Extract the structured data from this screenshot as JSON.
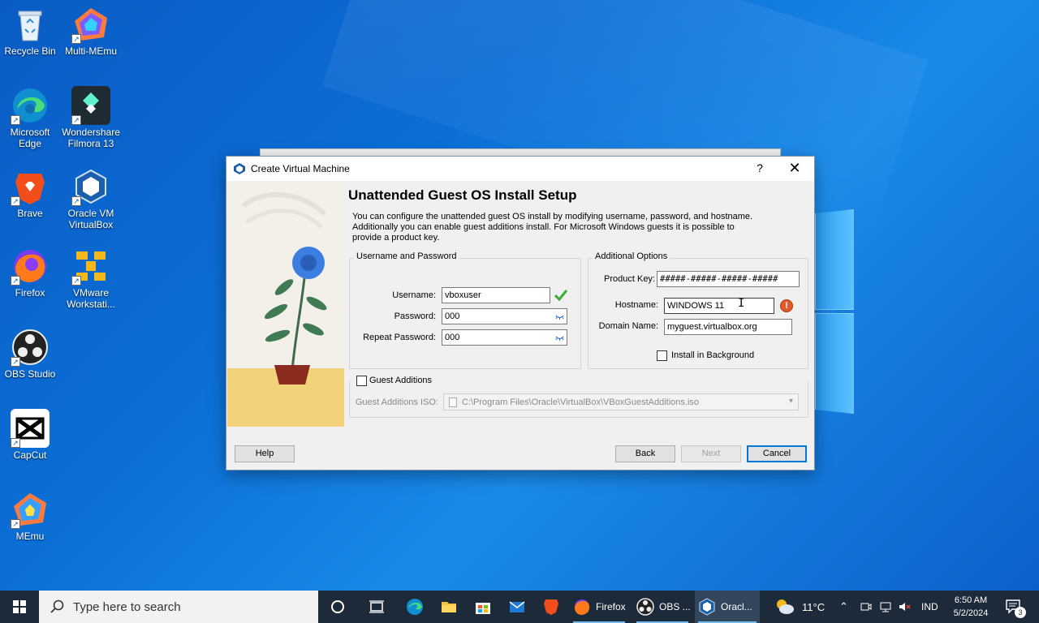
{
  "desktop": {
    "icons": [
      {
        "label": "Recycle Bin",
        "icon": "recycle-bin-icon"
      },
      {
        "label": "Multi-MEmu",
        "icon": "multi-memu-icon"
      },
      {
        "label": "Microsoft Edge",
        "icon": "edge-icon"
      },
      {
        "label": "Wondershare Filmora 13",
        "icon": "filmora-icon"
      },
      {
        "label": "Brave",
        "icon": "brave-icon"
      },
      {
        "label": "Oracle VM VirtualBox",
        "icon": "virtualbox-icon"
      },
      {
        "label": "Firefox",
        "icon": "firefox-icon"
      },
      {
        "label": "VMware Workstati...",
        "icon": "vmware-icon"
      },
      {
        "label": "OBS Studio",
        "icon": "obs-icon"
      },
      {
        "label": "CapCut",
        "icon": "capcut-icon"
      },
      {
        "label": "MEmu",
        "icon": "memu-icon"
      }
    ]
  },
  "dialog": {
    "title": "Create Virtual Machine",
    "help_glyph": "?",
    "close_glyph": "✕",
    "heading": "Unattended Guest OS Install Setup",
    "description": "You can configure the unattended guest OS install by modifying username, password, and hostname. Additionally you can enable guest additions install. For Microsoft Windows guests it is possible to provide a product key.",
    "credentials": {
      "legend": "Username and Password",
      "username_label": "Username:",
      "username_value": "vboxuser",
      "password_label": "Password:",
      "password_value": "000",
      "repeat_label": "Repeat Password:",
      "repeat_value": "000"
    },
    "options": {
      "legend": "Additional Options",
      "product_key_label": "Product Key:",
      "product_key_value": "#####-#####-#####-#####",
      "hostname_label": "Hostname:",
      "hostname_value": "WINDOWS 11",
      "domain_label": "Domain Name:",
      "domain_value": "myguest.virtualbox.org",
      "install_bg_label": "Install in Background",
      "install_bg_checked": false
    },
    "guest_additions": {
      "label": "Guest Additions",
      "checked": false,
      "iso_label": "Guest Additions ISO:",
      "iso_value": "C:\\Program Files\\Oracle\\VirtualBox\\VBoxGuestAdditions.iso"
    },
    "buttons": {
      "help": "Help",
      "back": "Back",
      "next": "Next",
      "cancel": "Cancel"
    }
  },
  "taskbar": {
    "search_placeholder": "Type here to search",
    "apps": [
      {
        "label": "",
        "icon": "task-view-icon"
      },
      {
        "label": "",
        "icon": "edge-icon"
      },
      {
        "label": "",
        "icon": "file-explorer-icon"
      },
      {
        "label": "",
        "icon": "store-icon"
      },
      {
        "label": "",
        "icon": "mail-icon"
      },
      {
        "label": "",
        "icon": "brave-icon"
      },
      {
        "label": "Firefox",
        "icon": "firefox-icon"
      },
      {
        "label": "OBS ...",
        "icon": "obs-icon"
      },
      {
        "label": "Oracl...",
        "icon": "virtualbox-icon"
      }
    ],
    "weather": "11°C",
    "language": "IND",
    "time": "6:50 AM",
    "date": "5/2/2024",
    "notifications_count": "3"
  },
  "colors": {
    "desktop_blue": "#0b6fd6",
    "taskbar": "#1c2a3a",
    "accent": "#0078d7",
    "warning": "#e05a2c",
    "check_green": "#3cb034"
  }
}
